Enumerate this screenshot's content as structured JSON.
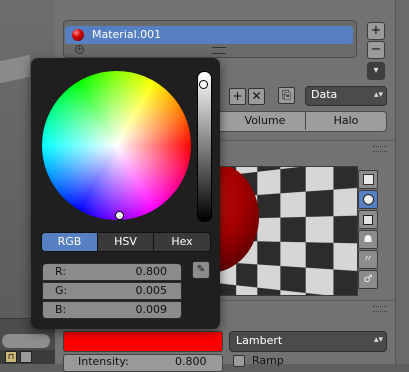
{
  "material_slots": {
    "items": [
      {
        "label": "Material.001",
        "selected": true,
        "color": "#cc0000"
      }
    ],
    "add_button": "+",
    "remove_button": "−",
    "menu_button": "▾"
  },
  "datablock": {
    "add_glyph": "+",
    "delete_glyph": "✕",
    "browse_glyph": "⎘",
    "data_select": "Data",
    "select_arrow": "▴▾"
  },
  "material_type_tabs": [
    {
      "label": "Volume"
    },
    {
      "label": "Halo"
    }
  ],
  "preview": {
    "buttons": [
      {
        "name": "flat"
      },
      {
        "name": "sphere",
        "active": true
      },
      {
        "name": "cube"
      },
      {
        "name": "monkey",
        "glyph": "☗"
      },
      {
        "name": "hair",
        "glyph": "〃"
      },
      {
        "name": "sky",
        "glyph": "♂"
      }
    ]
  },
  "diffuse": {
    "color": "#ff0000",
    "shader": "Lambert",
    "shader_arrow": "▴▾",
    "intensity_label": "Intensity:",
    "intensity_value": "0.800",
    "ramp_label": "Ramp"
  },
  "color_picker": {
    "modes": [
      {
        "label": "RGB",
        "active": true
      },
      {
        "label": "HSV"
      },
      {
        "label": "Hex"
      }
    ],
    "channels": [
      {
        "label": "R:",
        "value": "0.800"
      },
      {
        "label": "G:",
        "value": "0.005"
      },
      {
        "label": "B:",
        "value": "0.009"
      }
    ],
    "eyedropper_glyph": "✎"
  },
  "viewport": {
    "icon_glyph": "⊓"
  }
}
